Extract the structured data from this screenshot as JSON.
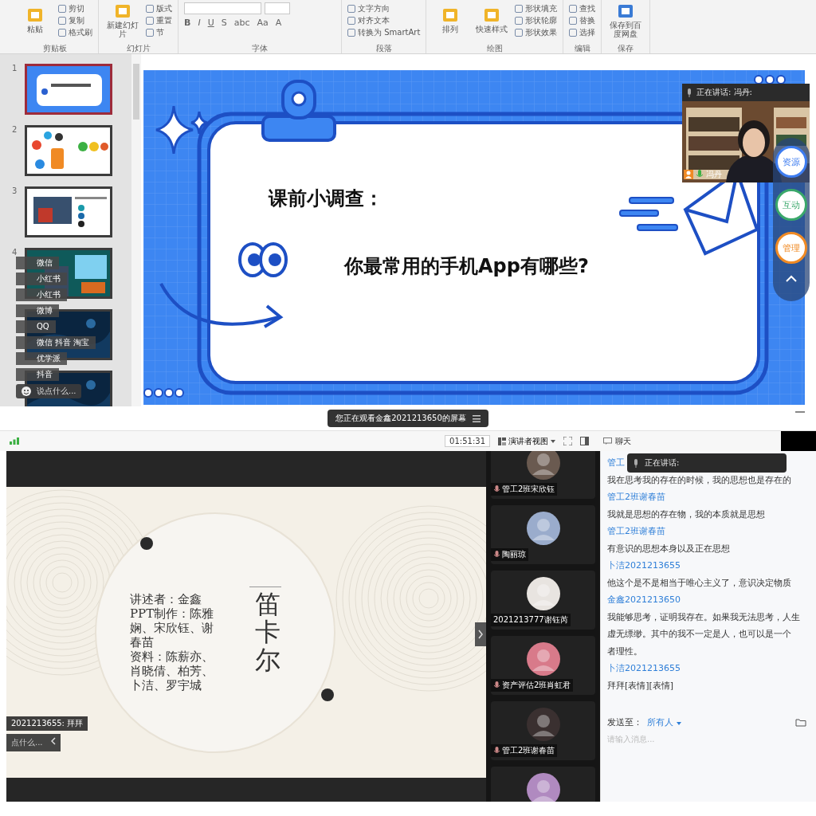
{
  "ribbon": {
    "groups": [
      {
        "label": "剪贴板",
        "items": [
          {
            "label": "粘贴",
            "kind": "large"
          },
          {
            "label": "剪切",
            "kind": "small"
          },
          {
            "label": "复制",
            "kind": "small"
          },
          {
            "label": "格式刷",
            "kind": "small"
          }
        ]
      },
      {
        "label": "幻灯片",
        "items": [
          {
            "label": "新建幻灯片",
            "kind": "large"
          },
          {
            "label": "版式",
            "kind": "small"
          },
          {
            "label": "重置",
            "kind": "small"
          },
          {
            "label": "节",
            "kind": "small"
          }
        ]
      },
      {
        "label": "字体",
        "items": [
          {
            "label": "B",
            "kind": "glyph"
          },
          {
            "label": "I",
            "kind": "glyph"
          },
          {
            "label": "U",
            "kind": "glyph"
          },
          {
            "label": "S",
            "kind": "glyph"
          },
          {
            "label": "abc",
            "kind": "glyph"
          },
          {
            "label": "Aa",
            "kind": "glyph"
          },
          {
            "label": "A",
            "kind": "glyph"
          }
        ]
      },
      {
        "label": "段落",
        "items": [
          {
            "label": "文字方向",
            "kind": "small"
          },
          {
            "label": "对齐文本",
            "kind": "small"
          },
          {
            "label": "转换为 SmartArt",
            "kind": "small"
          }
        ]
      },
      {
        "label": "绘图",
        "items": [
          {
            "label": "排列",
            "kind": "large"
          },
          {
            "label": "快速样式",
            "kind": "large"
          },
          {
            "label": "形状填充",
            "kind": "small"
          },
          {
            "label": "形状轮廓",
            "kind": "small"
          },
          {
            "label": "形状效果",
            "kind": "small"
          }
        ]
      },
      {
        "label": "编辑",
        "items": [
          {
            "label": "查找",
            "kind": "small"
          },
          {
            "label": "替换",
            "kind": "small"
          },
          {
            "label": "选择",
            "kind": "small"
          }
        ]
      },
      {
        "label": "保存",
        "items": [
          {
            "label": "保存到百度网盘",
            "kind": "large"
          }
        ]
      }
    ]
  },
  "slides": [
    {
      "number": "1",
      "kind": "title",
      "selected": true
    },
    {
      "number": "2",
      "kind": "apps",
      "selected": false
    },
    {
      "number": "3",
      "selected": false
    },
    {
      "number": "4",
      "kind": "dark",
      "selected": false
    },
    {
      "kind": "night",
      "selected": false
    },
    {
      "kind": "night",
      "selected": false
    }
  ],
  "thumb_danmu": {
    "messages": [
      "微信",
      "小红书",
      "小红书",
      "微博",
      "QQ",
      "微信 抖音 淘宝",
      "优学派",
      "抖音"
    ],
    "placeholder": "说点什么..."
  },
  "slide": {
    "title": "课前小调查：",
    "question": "你最常用的手机App有哪些?"
  },
  "speaker_video": {
    "status": "正在讲话: 冯丹:",
    "name": "冯丹"
  },
  "side_buttons": [
    {
      "label": "资源",
      "color": "#3d7cf0"
    },
    {
      "label": "互动",
      "color": "#3aa86b"
    },
    {
      "label": "管理",
      "color": "#f08a24"
    }
  ],
  "viewer": {
    "banner": "您正在观看金鑫2021213650的屏幕",
    "timer": "01:51:31",
    "view_mode": "演讲者视图",
    "chat_tab": "聊天"
  },
  "shared_slide": {
    "title": "笛卡尔",
    "credits": [
      "讲述者：金鑫",
      "PPT制作：陈雅娴、宋欣钰、谢春苗",
      "资料：陈薪亦、肖晓倩、柏芳、卜洁、罗宇城"
    ]
  },
  "shared_danmu": {
    "message": "2021213655: 拜拜",
    "placeholder": "点什么..."
  },
  "participants": [
    {
      "kind": "full",
      "name": "管工2班宋欣钰"
    },
    {
      "kind": "full",
      "name": "陶丽琼"
    },
    {
      "kind": "full",
      "name": "2021213777谢钰芮"
    },
    {
      "kind": "full",
      "name": "资产评估2班肖虹君"
    },
    {
      "kind": "full",
      "name": "管工2班谢春苗"
    },
    {
      "kind": "partial"
    }
  ],
  "chat": {
    "speaking": "正在讲话:",
    "messages": [
      {
        "sender": "管工",
        "lines": [
          "我在思考我的存在的时候，我的思想也是存在的"
        ]
      },
      {
        "sender": "管工2班谢春苗",
        "lines": [
          "我就是思想的存在物，我的本质就是思想"
        ]
      },
      {
        "sender": "管工2班谢春苗",
        "lines": [
          "有意识的思想本身以及正在思想"
        ]
      },
      {
        "sender": "卜洁2021213655",
        "lines": [
          "他这个是不是相当于唯心主义了，意识决定物质"
        ]
      },
      {
        "sender": "金鑫2021213650",
        "lines": [
          "我能够思考，证明我存在。如果我无法思考，人生",
          "虚无缥缈。其中的我不一定是人，也可以是一个",
          "者理性。"
        ]
      },
      {
        "sender": "卜洁2021213655",
        "lines": [
          "拜拜[表情][表情]"
        ]
      }
    ],
    "send_to_label": "发送至：",
    "recipient": "所有人",
    "placeholder": "请输入消息..."
  }
}
